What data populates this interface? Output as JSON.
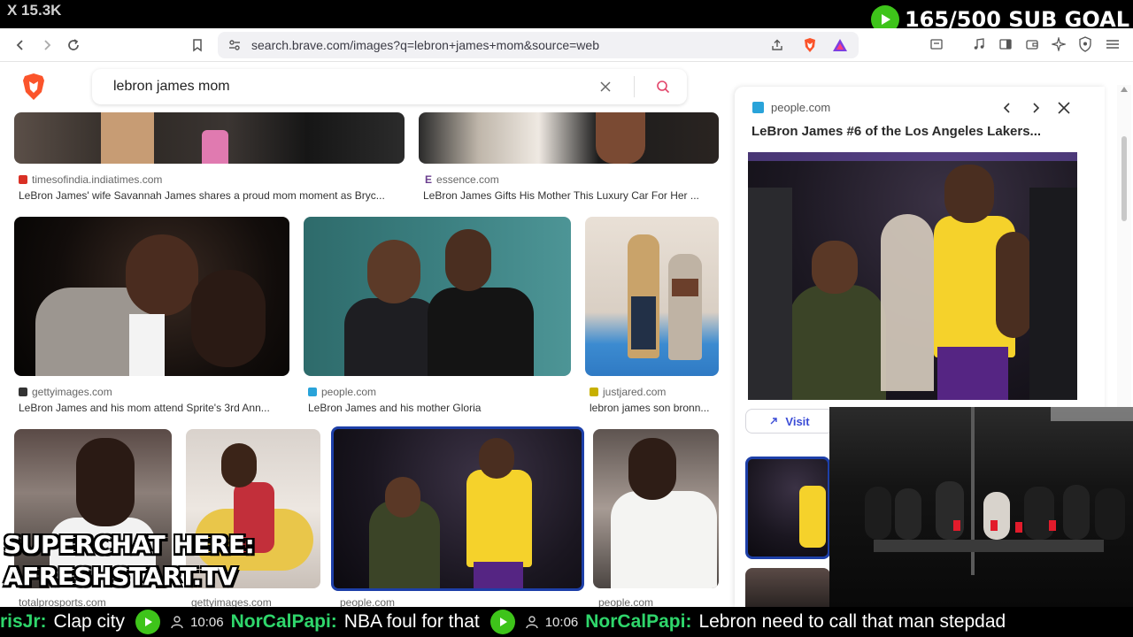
{
  "overlay": {
    "x_count": "X 15.3K",
    "sub_goal": "165/500 SUB GOAL",
    "superchat_line1": "SUPERCHAT HERE:",
    "superchat_line2": "AFRESHSTART.TV"
  },
  "browser": {
    "url": "search.brave.com/images?q=lebron+james+mom&source=web"
  },
  "search": {
    "query": "lebron james mom"
  },
  "results": {
    "row1": [
      {
        "source": "timesofindia.indiatimes.com",
        "caption": "LeBron James' wife Savannah James shares a proud mom moment as Bryc...",
        "fav_color": "#d93025"
      },
      {
        "source": "essence.com",
        "caption": "LeBron James Gifts His Mother This Luxury Car For Her ...",
        "fav_glyph": "E"
      }
    ],
    "row2": [
      {
        "source": "gettyimages.com",
        "caption": "LeBron James and his mom attend Sprite's 3rd Ann...",
        "fav_color": "#333333"
      },
      {
        "source": "people.com",
        "caption": "LeBron James and his mother Gloria",
        "fav_color": "#29a3d9"
      },
      {
        "source": "justjared.com",
        "caption": "lebron james son bronn...",
        "fav_color": "#c7b000"
      }
    ],
    "row3_sources": [
      "totalprosports.com",
      "gettyimages.com",
      "people.com",
      "people.com"
    ]
  },
  "panel": {
    "source": "people.com",
    "title": "LeBron James #6 of the Los Angeles Lakers...",
    "visit_label": "Visit"
  },
  "ticker": {
    "messages": [
      {
        "user": "risJr:",
        "text": "Clap city"
      },
      {
        "time": "10:06",
        "user": "NorCalPapi:",
        "text": "NBA foul for that"
      },
      {
        "time": "10:06",
        "user": "NorCalPapi:",
        "text": "Lebron need to call that man stepdad"
      }
    ]
  },
  "colors": {
    "brand_orange": "#fb542b",
    "accent_blue": "#3b4cd6",
    "chat_green": "#2fd66b",
    "badge_green": "#3ec41a",
    "lakers_gold": "#f5d22b",
    "lakers_purple": "#552583"
  }
}
